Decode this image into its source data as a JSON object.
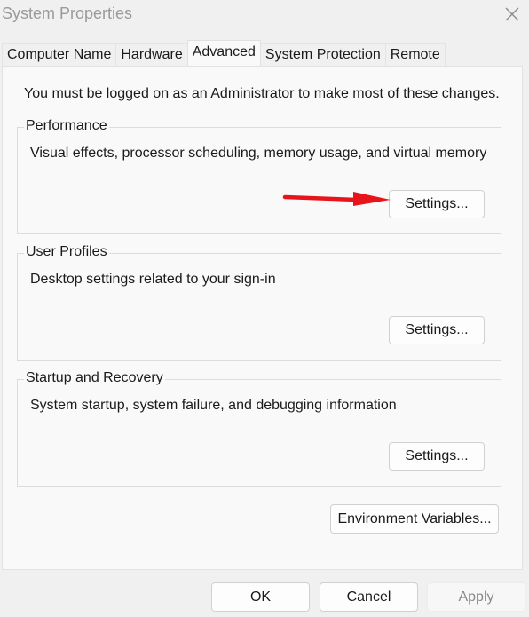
{
  "window": {
    "title": "System Properties",
    "close_icon": "close-x-icon"
  },
  "tabs": [
    {
      "label": "Computer Name",
      "active": false
    },
    {
      "label": "Hardware",
      "active": false
    },
    {
      "label": "Advanced",
      "active": true
    },
    {
      "label": "System Protection",
      "active": false
    },
    {
      "label": "Remote",
      "active": false
    }
  ],
  "advanced": {
    "admin_note": "You must be logged on as an Administrator to make most of these changes.",
    "groups": [
      {
        "title": "Performance",
        "description": "Visual effects, processor scheduling, memory usage, and virtual memory",
        "button_label": "Settings..."
      },
      {
        "title": "User Profiles",
        "description": "Desktop settings related to your sign-in",
        "button_label": "Settings..."
      },
      {
        "title": "Startup and Recovery",
        "description": "System startup, system failure, and debugging information",
        "button_label": "Settings..."
      }
    ],
    "environment_variables_label": "Environment Variables..."
  },
  "footer": {
    "ok_label": "OK",
    "cancel_label": "Cancel",
    "apply_label": "Apply",
    "apply_enabled": false
  },
  "annotation": {
    "arrow_color": "#e8141b",
    "arrow_target": "Performance Settings button"
  }
}
